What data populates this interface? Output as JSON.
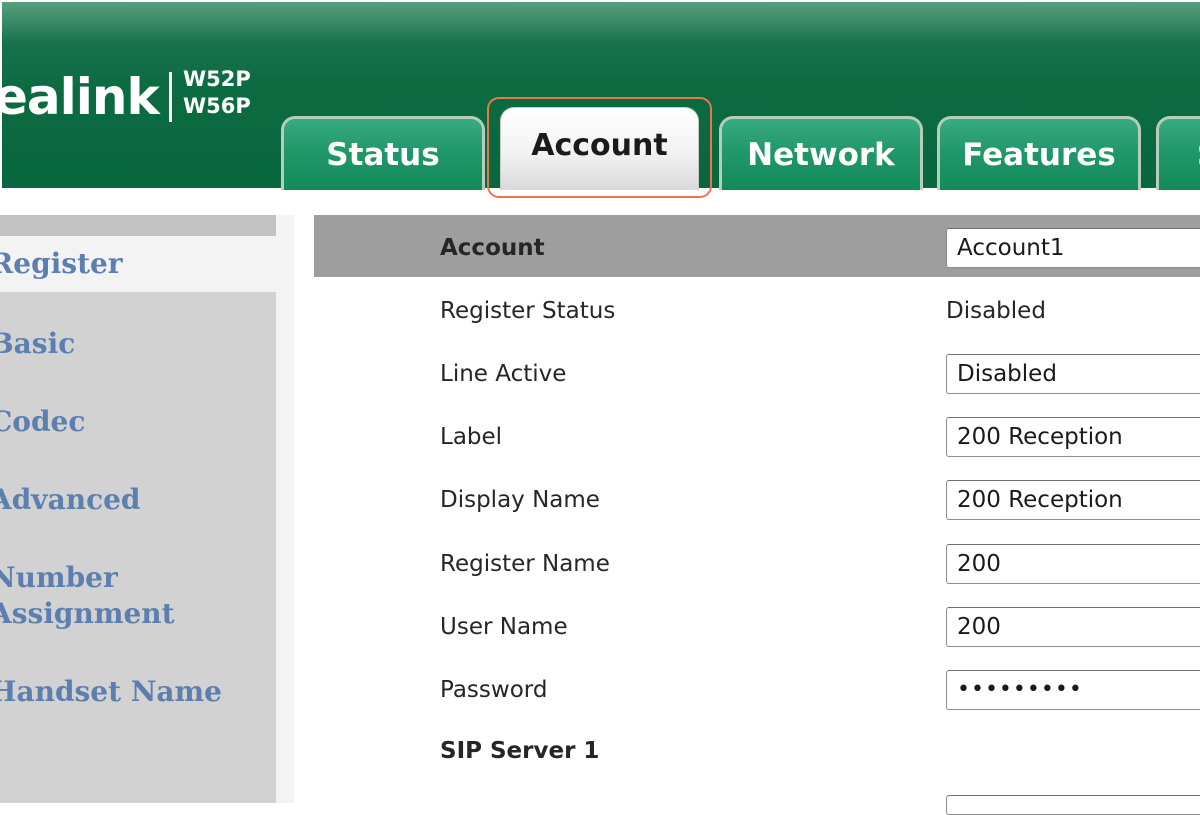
{
  "header": {
    "logo_text": "ealink",
    "models": [
      "W52P",
      "W56P"
    ]
  },
  "tabs": [
    {
      "id": "status",
      "label": "Status"
    },
    {
      "id": "account",
      "label": "Account",
      "selected": true
    },
    {
      "id": "network",
      "label": "Network"
    },
    {
      "id": "features",
      "label": "Features"
    },
    {
      "id": "more",
      "label": "S"
    }
  ],
  "sidebar": {
    "items": [
      {
        "label": "Register",
        "selected": true
      },
      {
        "label": "Basic"
      },
      {
        "label": "Codec"
      },
      {
        "label": "Advanced"
      },
      {
        "label": "Number Assignment",
        "lines": [
          "Number",
          "Assignment"
        ]
      },
      {
        "label": "Handset Name"
      }
    ]
  },
  "form": {
    "account": {
      "label": "Account",
      "value": "Account1"
    },
    "register_status": {
      "label": "Register Status",
      "value": "Disabled"
    },
    "line_active": {
      "label": "Line Active",
      "value": "Disabled"
    },
    "label_field": {
      "label": "Label",
      "value": "200 Reception"
    },
    "display_name": {
      "label": "Display Name",
      "value": "200 Reception"
    },
    "register_name": {
      "label": "Register Name",
      "value": "200"
    },
    "user_name": {
      "label": "User Name",
      "value": "200"
    },
    "password": {
      "label": "Password",
      "value": "•••••••••"
    },
    "sip_server_1": {
      "label": "SIP Server 1"
    }
  },
  "colors": {
    "header_green": "#0d6b42",
    "tab_green": "#21986b",
    "highlight_orange": "#e8784a",
    "sidebar_link": "#5d7fb0",
    "sidebar_bg": "#d2d2d2",
    "account_row_bg": "#9e9e9e"
  }
}
